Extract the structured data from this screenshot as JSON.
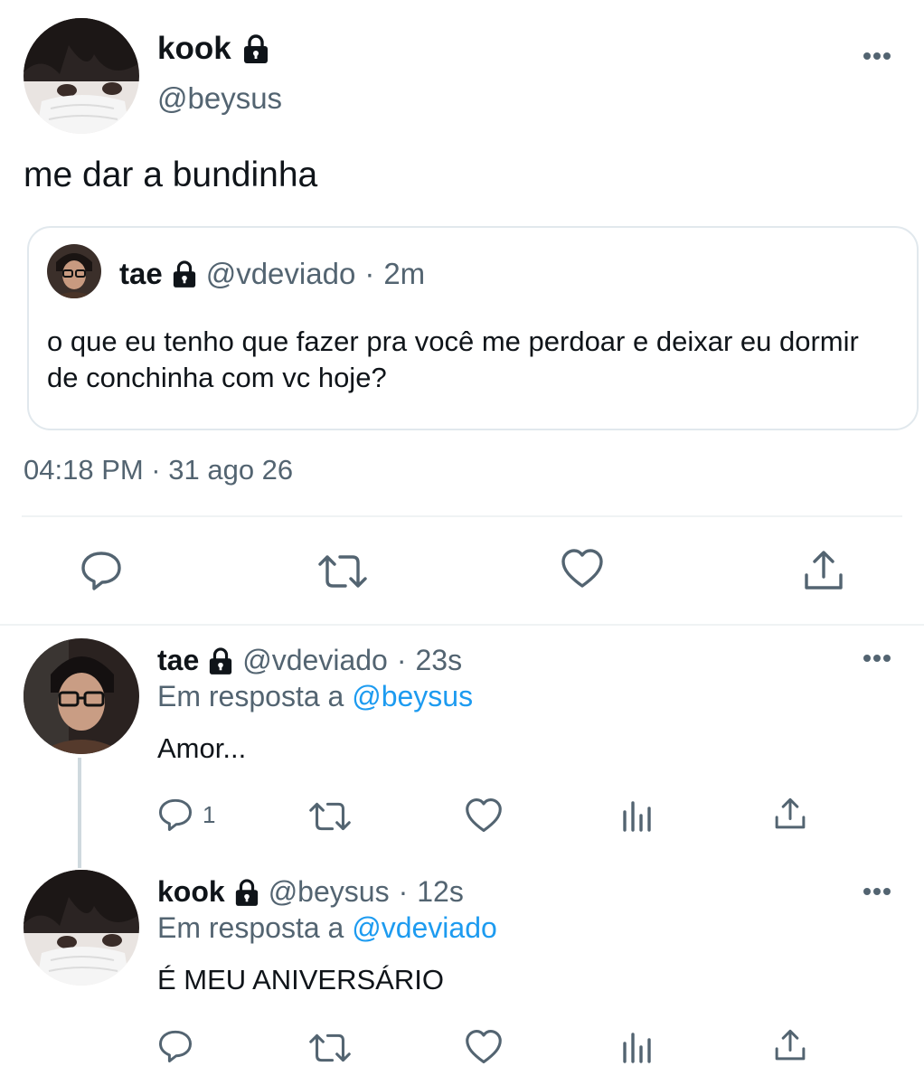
{
  "main_tweet": {
    "name": "kook",
    "handle": "@beysus",
    "text": "me dar a bundinha",
    "quoted": {
      "name": "tae",
      "handle": "@vdeviado",
      "separator": "·",
      "time": "2m",
      "text": "o que eu tenho que fazer pra você me perdoar e deixar eu dormir de conchinha com vc hoje?"
    },
    "timestamp": "04:18 PM · 31 ago 26"
  },
  "replies": [
    {
      "name": "tae",
      "handle": "@vdeviado",
      "separator": "·",
      "time": "23s",
      "reply_prefix": "Em resposta a",
      "reply_to": "@beysus",
      "text": "Amor...",
      "reply_count": "1"
    },
    {
      "name": "kook",
      "handle": "@beysus",
      "separator": "·",
      "time": "12s",
      "reply_prefix": "Em resposta a",
      "reply_to": "@vdeviado",
      "text": "É MEU ANIVERSÁRIO",
      "reply_count": ""
    }
  ],
  "colors": {
    "text": "#0f1419",
    "secondary": "#536471",
    "link": "#1d9bf0",
    "border": "#e1e8ed",
    "icon": "#536471"
  },
  "icons": [
    "lock-icon",
    "more-icon",
    "reply-icon",
    "retweet-icon",
    "like-icon",
    "share-icon",
    "analytics-icon"
  ]
}
